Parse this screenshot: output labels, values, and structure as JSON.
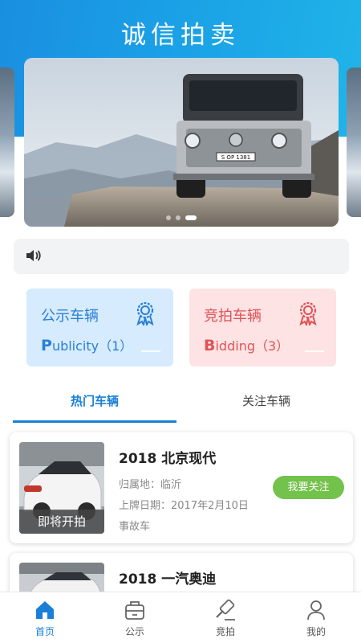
{
  "app": {
    "title": "诚信拍卖"
  },
  "banner": {
    "plate_text": "S OP 1381",
    "slide_count": 3,
    "active_slide": 2
  },
  "notice": {
    "icon": "speaker-icon",
    "text": ""
  },
  "categories": [
    {
      "title": "公示车辆",
      "en_initial": "P",
      "en_rest": "ublicity",
      "count": "（1）",
      "icon": "award-icon",
      "color": "#2a7fd6"
    },
    {
      "title": "竞拍车辆",
      "en_initial": "B",
      "en_rest": "idding",
      "count": "（3）",
      "icon": "award-icon",
      "color": "#e05256"
    }
  ],
  "tabs": {
    "hot": "热门车辆",
    "follow": "关注车辆",
    "active": "hot"
  },
  "cars": [
    {
      "title": "2018 北京现代",
      "location": "归属地：临沂",
      "plate_date": "上牌日期：2017年2月10日",
      "type": "事故车",
      "status": "即将开拍",
      "action": "我要关注"
    },
    {
      "title": "2018 一汽奥迪"
    }
  ],
  "nav": [
    {
      "label": "首页",
      "icon": "home-icon",
      "active": true
    },
    {
      "label": "公示",
      "icon": "notice-box-icon",
      "active": false
    },
    {
      "label": "竞拍",
      "icon": "gavel-icon",
      "active": false
    },
    {
      "label": "我的",
      "icon": "user-icon",
      "active": false
    }
  ],
  "colors": {
    "primary": "#1a8fe0",
    "public_bg": "#d6ebfd",
    "bid_bg": "#fde3e4",
    "follow_btn": "#73c24b"
  }
}
